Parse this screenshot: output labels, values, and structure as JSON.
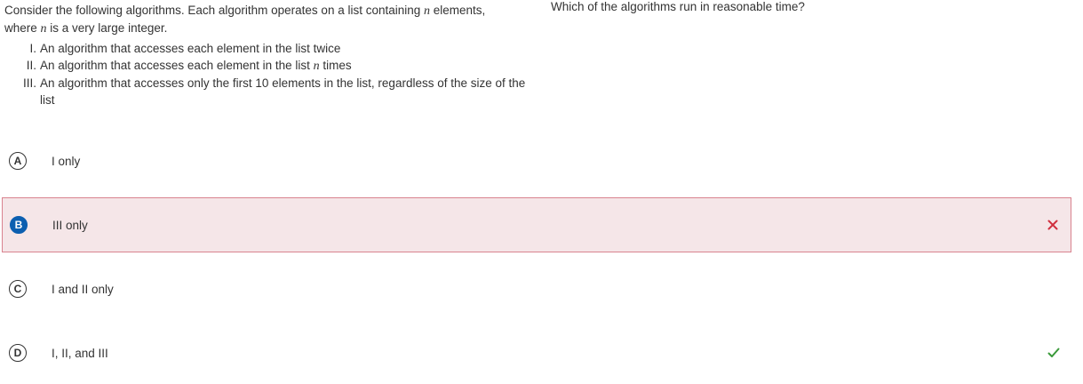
{
  "stimulus": {
    "intro_part1": "Consider the following algorithms. Each algorithm operates on a list containing ",
    "intro_var": "n",
    "intro_part2": " elements,",
    "intro_line2_part1": "where ",
    "intro_line2_var": "n",
    "intro_line2_part2": " is a very large integer.",
    "statements": [
      {
        "numeral": "I.",
        "text_a": "An algorithm that accesses each element in the list twice",
        "var": "",
        "text_b": ""
      },
      {
        "numeral": "II.",
        "text_a": "An algorithm that accesses each element in the list ",
        "var": "n",
        "text_b": " times"
      },
      {
        "numeral": "III.",
        "text_a": "An algorithm that accesses only the first 10 elements in the list, regardless of the size of the list",
        "var": "",
        "text_b": ""
      }
    ]
  },
  "question": {
    "text": "Which of the algorithms run in reasonable time?"
  },
  "choices": [
    {
      "letter": "A",
      "label": "I only",
      "state": "none"
    },
    {
      "letter": "B",
      "label": "III only",
      "state": "selected-incorrect"
    },
    {
      "letter": "C",
      "label": "I and II only",
      "state": "none"
    },
    {
      "letter": "D",
      "label": "I, II, and III",
      "state": "correct"
    }
  ],
  "colors": {
    "selected_badge": "#0c5fb0",
    "wrong_bg": "#f5e6e8",
    "wrong_border": "#d9838f",
    "wrong_mark": "#d0303f",
    "correct_mark": "#3a9a3a"
  },
  "icons": {
    "incorrect": "x-mark-icon",
    "correct": "checkmark-icon"
  }
}
